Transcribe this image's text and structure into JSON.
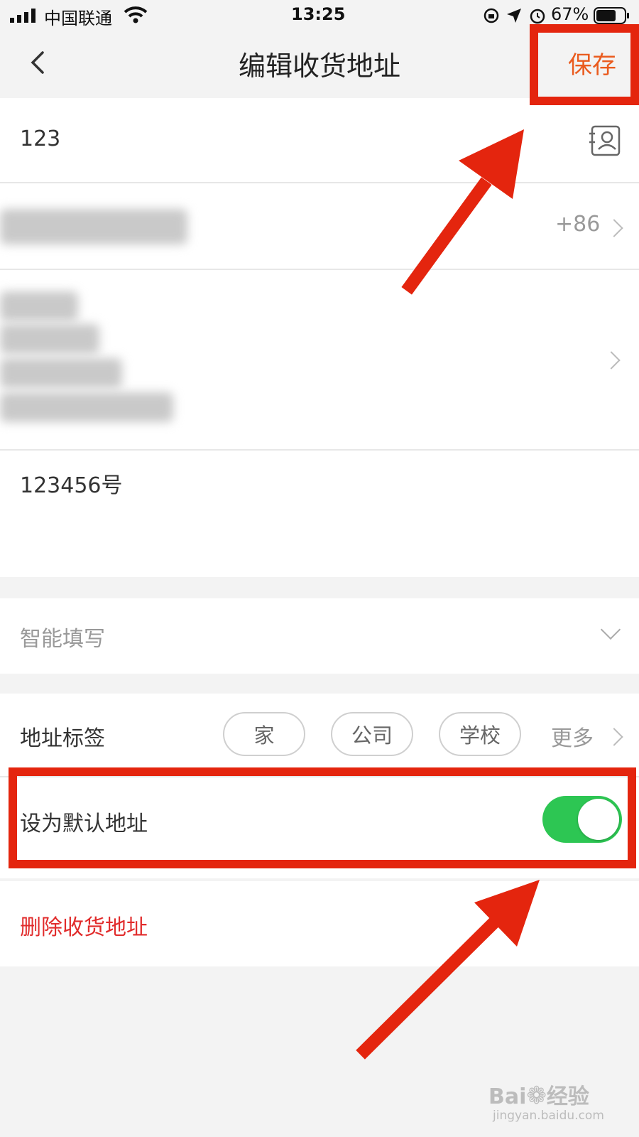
{
  "status_bar": {
    "carrier": "中国联通",
    "time": "13:25",
    "battery": "67%"
  },
  "nav": {
    "title": "编辑收货地址",
    "save_label": "保存"
  },
  "form": {
    "name_value": "123",
    "phone_prefix": "+86",
    "detail_address": "123456号"
  },
  "smart_fill": {
    "label": "智能填写"
  },
  "tags": {
    "label": "地址标签",
    "options": [
      "家",
      "公司",
      "学校"
    ],
    "more_label": "更多"
  },
  "default_address": {
    "label": "设为默认地址",
    "enabled": true
  },
  "delete": {
    "label": "删除收货地址"
  },
  "watermark": {
    "brand": "Bai",
    "brand2": "经验",
    "url": "jingyan.baidu.com"
  },
  "colors": {
    "accent": "#ea5b1e",
    "toggle_on": "#2dc653",
    "delete_red": "#e12b2b",
    "annotation_red": "#e4250e"
  }
}
